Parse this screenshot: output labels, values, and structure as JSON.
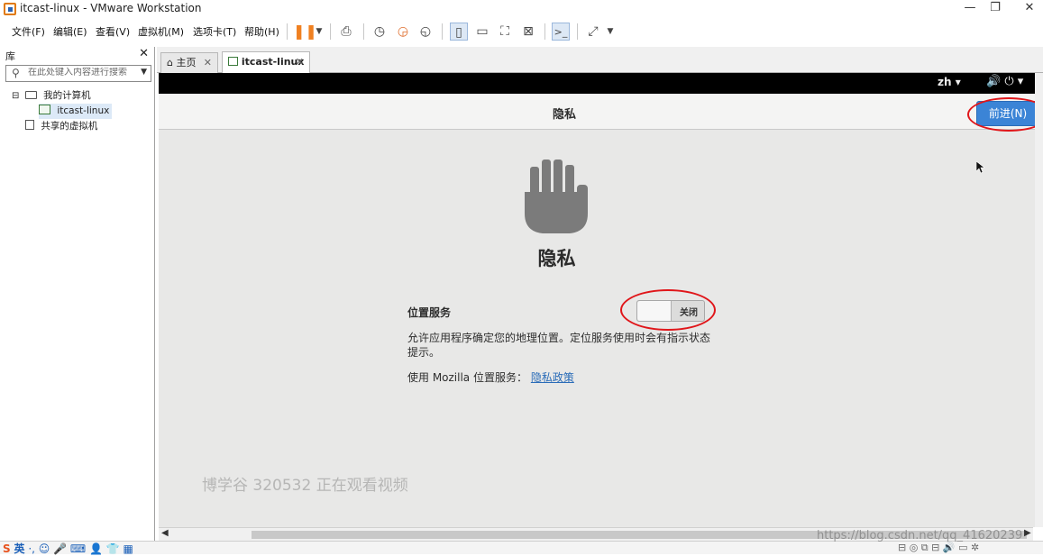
{
  "window": {
    "title": "itcast-linux - VMware Workstation",
    "minimize": "—",
    "restore": "❐",
    "close": "✕"
  },
  "menu": {
    "items": [
      "文件(F)",
      "编辑(E)",
      "查看(V)",
      "虚拟机(M)",
      "选项卡(T)",
      "帮助(H)"
    ]
  },
  "library": {
    "title": "库",
    "close": "✕",
    "search_placeholder": "在此处键入内容进行搜索",
    "tree": {
      "my_computer": "我的计算机",
      "vm": "itcast-linux",
      "shared": "共享的虚拟机"
    },
    "tree_toggle": "⊟"
  },
  "tabs": [
    {
      "label": "主页",
      "close": "✕"
    },
    {
      "label": "itcast-linux",
      "close": "✕"
    }
  ],
  "guest": {
    "topbar": {
      "lang": "zh ▾",
      "sys_icons": "🔊  ⏻ ▾"
    },
    "header_title": "隐私",
    "next_button": "前进(N)",
    "page_title": "隐私",
    "location_label": "位置服务",
    "toggle_state": "关闭",
    "location_on": false,
    "description": "允许应用程序确定您的地理位置。定位服务使用时会有指示状态提示。",
    "mozilla_prefix": "使用  Mozilla 位置服务：",
    "privacy_link": "隐私政策",
    "watermark": "博学谷 320532 正在观看视频"
  },
  "statusbar": {
    "ime_logo": "S",
    "ime_lang": "英",
    "ime_icons": "·, ☺ 🎤 ⌨ 👤 👕 ▦",
    "url_watermark": "https://blog.csdn.net/qq_41620239",
    "right_icons": "⊟ ◎ ⧉ ⊟ 🔊 ▭ ✲"
  },
  "colors": {
    "accent_blue": "#3b84d6",
    "annotation_red": "#e0161a",
    "vmware_orange": "#f08020",
    "guest_bg": "#e8e8e7"
  }
}
